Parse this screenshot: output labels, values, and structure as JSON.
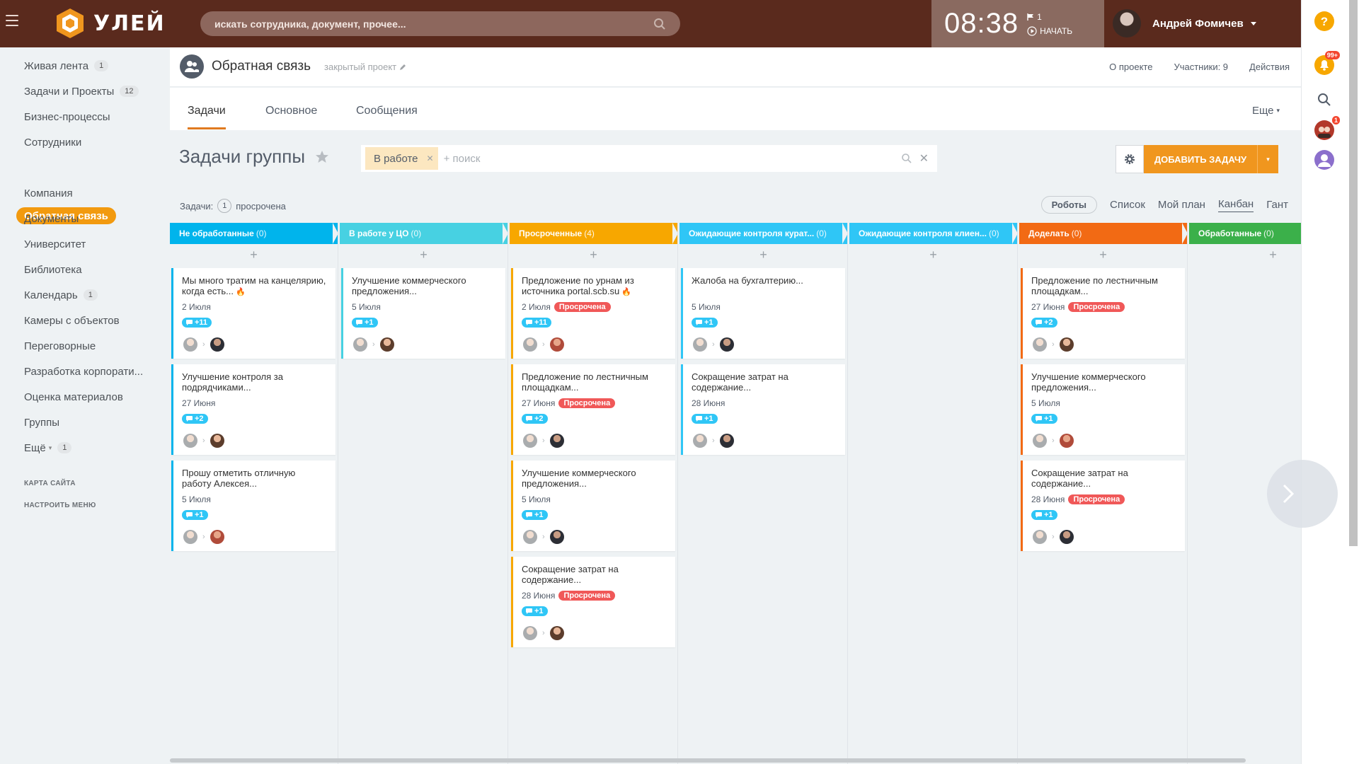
{
  "header": {
    "logo_text": "УЛЕЙ",
    "search_placeholder": "искать сотрудника, документ, прочее...",
    "clock": "08:38",
    "flag_count": "1",
    "start_label": "НАЧАТЬ",
    "user_name": "Андрей Фомичев"
  },
  "sidebar": {
    "items": [
      {
        "label": "Живая лента",
        "count": "1"
      },
      {
        "label": "Задачи и Проекты",
        "count": "12"
      },
      {
        "label": "Бизнес-процессы",
        "count": ""
      },
      {
        "label": "Сотрудники",
        "count": ""
      },
      {
        "label": "Обратная связь",
        "count": ""
      },
      {
        "label": "Компания",
        "count": ""
      },
      {
        "label": "Документы",
        "count": ""
      },
      {
        "label": "Университет",
        "count": ""
      },
      {
        "label": "Библиотека",
        "count": ""
      },
      {
        "label": "Календарь",
        "count": "1"
      },
      {
        "label": "Камеры с объектов",
        "count": ""
      },
      {
        "label": "Переговорные",
        "count": ""
      },
      {
        "label": "Разработка корпорати...",
        "count": ""
      },
      {
        "label": "Оценка материалов",
        "count": ""
      },
      {
        "label": "Группы",
        "count": ""
      },
      {
        "label": "Ещё",
        "count": "1"
      }
    ],
    "site_map": "КАРТА САЙТА",
    "configure_menu": "НАСТРОИТЬ МЕНЮ"
  },
  "project": {
    "title": "Обратная связь",
    "closed_label": "закрытый проект",
    "links": [
      "О проекте",
      "Участники: 9",
      "Действия"
    ]
  },
  "tabs": {
    "items": [
      "Задачи",
      "Основное",
      "Сообщения"
    ],
    "more": "Еще"
  },
  "toolbar": {
    "page_title": "Задачи группы",
    "filter_chip": "В работе",
    "filter_placeholder": "+ поиск",
    "add_task": "ДОБАВИТЬ ЗАДАЧУ"
  },
  "stats": {
    "label": "Задачи:",
    "overdue_count": "1",
    "overdue_label": "просрочена"
  },
  "views": [
    "Роботы",
    "Список",
    "Мой план",
    "Канбан",
    "Гант"
  ],
  "rail": {
    "notifications_badge": "99+",
    "second_badge": "1"
  },
  "overdue_label": "Просрочена",
  "columns": [
    {
      "title": "Не обработанные",
      "count": "(0)",
      "color": "#00b4ec"
    },
    {
      "title": "В работе у ЦО",
      "count": "(0)",
      "color": "#47d1e2"
    },
    {
      "title": "Просроченные",
      "count": "(4)",
      "color": "#f7a700"
    },
    {
      "title": "Ожидающие контроля курат...",
      "count": "(0)",
      "color": "#2fc6f6"
    },
    {
      "title": "Ожидающие контроля клиен...",
      "count": "(0)",
      "color": "#2fc6f6"
    },
    {
      "title": "Доделать",
      "count": "(0)",
      "color": "#f26a14"
    },
    {
      "title": "Обработанные",
      "count": "(0)",
      "color": "#3bb04a"
    }
  ],
  "cards": {
    "col0": [
      {
        "title": "Мы много тратим на канцелярию, когда есть...",
        "fire": true,
        "date": "2 Июля",
        "overdue": false,
        "comments": "+11"
      },
      {
        "title": "Улучшение контроля за подрядчиками...",
        "fire": false,
        "date": "27 Июня",
        "overdue": false,
        "comments": "+2"
      },
      {
        "title": "Прошу отметить отличную работу Алексея...",
        "fire": false,
        "date": "5 Июля",
        "overdue": false,
        "comments": "+1"
      }
    ],
    "col1": [
      {
        "title": "Улучшение коммерческого предложения...",
        "fire": false,
        "date": "5 Июля",
        "overdue": false,
        "comments": "+1"
      }
    ],
    "col2": [
      {
        "title": "Предложение по урнам из источника portal.scb.su",
        "fire": true,
        "date": "2 Июля",
        "overdue": true,
        "comments": "+11"
      },
      {
        "title": "Предложение по лестничным площадкам...",
        "fire": false,
        "date": "27 Июня",
        "overdue": true,
        "comments": "+2"
      },
      {
        "title": "Улучшение коммерческого предложения...",
        "fire": false,
        "date": "5 Июля",
        "overdue": false,
        "comments": "+1"
      },
      {
        "title": "Сокращение затрат на содержание...",
        "fire": false,
        "date": "28 Июня",
        "overdue": true,
        "comments": "+1"
      }
    ],
    "col3": [
      {
        "title": "Жалоба на бухгалтерию...",
        "fire": false,
        "date": "5 Июля",
        "overdue": false,
        "comments": "+1"
      },
      {
        "title": "Сокращение затрат на содержание...",
        "fire": false,
        "date": "28 Июня",
        "overdue": false,
        "comments": "+1"
      }
    ],
    "col4": [],
    "col5": [
      {
        "title": "Предложение по лестничным площадкам...",
        "fire": false,
        "date": "27 Июня",
        "overdue": true,
        "comments": "+2"
      },
      {
        "title": "Улучшение коммерческого предложения...",
        "fire": false,
        "date": "5 Июля",
        "overdue": false,
        "comments": "+1"
      },
      {
        "title": "Сокращение затрат на содержание...",
        "fire": false,
        "date": "28 Июня",
        "overdue": true,
        "comments": "+1"
      }
    ],
    "col6": []
  }
}
